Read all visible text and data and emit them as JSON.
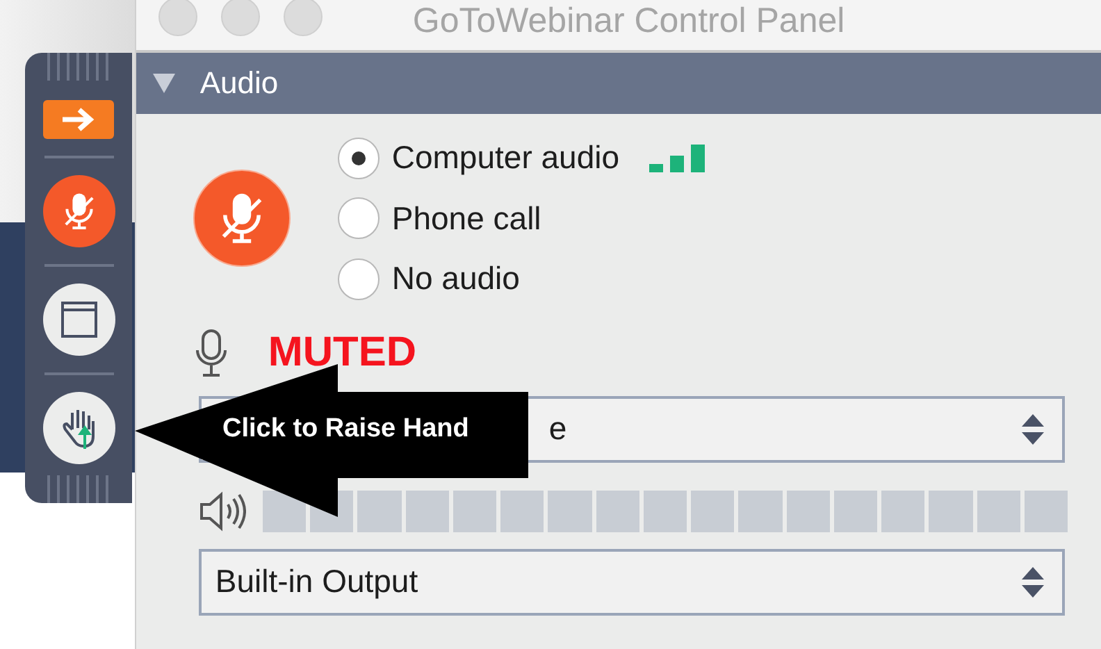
{
  "window": {
    "title": "GoToWebinar Control Panel"
  },
  "toolbar": {
    "buttons": [
      {
        "kind": "expand"
      },
      {
        "kind": "mute",
        "muted": true
      },
      {
        "kind": "window"
      },
      {
        "kind": "hand"
      }
    ]
  },
  "audio": {
    "header": "Audio",
    "expanded": true,
    "muted": true,
    "options": [
      {
        "label": "Computer audio",
        "selected": true,
        "signal": true
      },
      {
        "label": "Phone call",
        "selected": false,
        "signal": false
      },
      {
        "label": "No audio",
        "selected": false,
        "signal": false
      }
    ],
    "mic_status": "MUTED",
    "microphone": {
      "value": "e"
    },
    "speaker_meter": {
      "level": 0
    },
    "speaker": {
      "value": "Built-in Output"
    }
  },
  "callout": {
    "text": "Click to Raise Hand"
  }
}
